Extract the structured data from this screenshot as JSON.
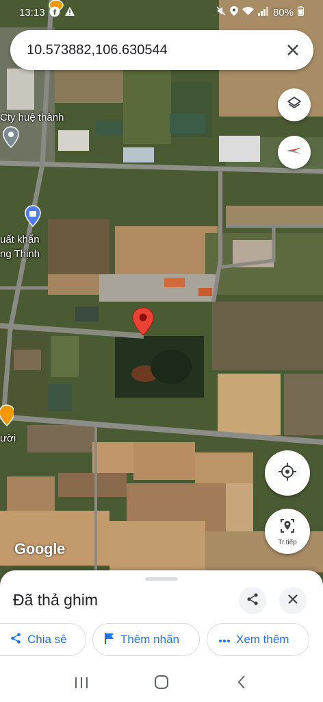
{
  "status_bar": {
    "time": "13:13",
    "battery": "80%",
    "left_icons": [
      "facebook-icon",
      "warning-icon"
    ],
    "right_icons": [
      "mute-icon",
      "location-icon",
      "wifi-icon",
      "signal-icon",
      "battery-icon"
    ]
  },
  "search": {
    "query": "10.573882,106.630544",
    "clear_icon": "close-icon"
  },
  "map": {
    "place_labels": [
      "Cty huệ thành",
      "uất khẩn",
      "ng Thịnh",
      "ười"
    ],
    "attribution": "Google",
    "pin_color": "#ea4335"
  },
  "map_controls": {
    "layers_icon": "layers-icon",
    "compass_icon": "compass-icon",
    "my_location_icon": "my-location-icon",
    "street_view_label": "Tr.tiếp"
  },
  "sheet": {
    "title": "Đã thả ghim",
    "share_icon": "share-icon",
    "close_icon": "close-icon",
    "chips": [
      {
        "label": "Chia sẻ",
        "icon": "share-icon"
      },
      {
        "label": "Thêm nhãn",
        "icon": "flag-icon"
      },
      {
        "label": "Xem thêm",
        "icon": "more-horiz-icon"
      }
    ]
  },
  "nav_bar": {
    "buttons": [
      "recent-apps-icon",
      "home-icon",
      "back-icon"
    ]
  },
  "colors": {
    "accent": "#1a73e8",
    "pin": "#ea4335"
  }
}
